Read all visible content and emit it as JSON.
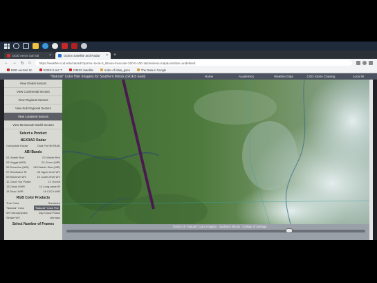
{
  "browser": {
    "tabs": [
      {
        "label": "DOD Aeros Sal Sal"
      },
      {
        "label": "GOES Satellite and Radar"
      }
    ],
    "url": "https://weather.cod.edu/satrad/?parms=local-S_Illinois-truecolor-200-0-100-1&checked=map&colorbar=undefined",
    "bookmarks": [
      {
        "label": "DOD Aerosol Sc",
        "color": "#cc2a2a"
      },
      {
        "label": "GOES Ε Δ Ε Τ",
        "color": "#cc2a2a"
      },
      {
        "label": "CIMSS Satellite",
        "color": "#cc2a2a"
      },
      {
        "label": "Index of /data_goes",
        "color": "#d6a33a"
      },
      {
        "label": "The Data in Google",
        "color": "#d6a33a"
      }
    ]
  },
  "page": {
    "title": "\"Natural\" Color Hier Imagery for Southern Illinois (GOES East)",
    "nav": [
      "Home",
      "Academics",
      "Weather Data",
      "COD Storm Chasing",
      "Local W"
    ]
  },
  "sidebar": {
    "view_links": [
      {
        "label": "View Global Sectors"
      },
      {
        "label": "View Continental Sectors"
      },
      {
        "label": "View Regional Sectors"
      },
      {
        "label": "View Sub Regional Sectors"
      },
      {
        "label": "View Localized Sectors"
      },
      {
        "label": "View Mesoscale Model Sectors"
      }
    ],
    "select_product": "Select a Product",
    "nexrad_head": "NEXRAD Radar",
    "nexrad_items": [
      "Composite Radar",
      "Dual Pol NEXRAD"
    ],
    "abi_head": "ABI Bands",
    "abi_rows": [
      [
        "01 Visible Blue",
        "02 Visible Red"
      ],
      [
        "03 Veggie (NIR)",
        "04 Cirrus (NIR)"
      ],
      [
        "05 Snow/Ice (NIR)",
        "06 Particle Size (NIR)"
      ],
      [
        "07 Shortwave IR",
        "08 Upper-level WV"
      ],
      [
        "09 Mid-level WV",
        "10 Lower-level WV"
      ],
      [
        "11 Cloud Top Phase",
        "12 Ozone"
      ],
      [
        "13 Clean LWIR",
        "14 Long-wave IR"
      ],
      [
        "15 Dirty LWIR",
        "16 CO2 LWIR"
      ]
    ],
    "rgb_head": "RGB Color Products",
    "rgb_rows": [
      [
        "True Color",
        "Sandwich"
      ],
      [
        "\"Natural\" Color",
        "\"Natural\" Color Fire"
      ],
      [
        "WV Microphysics",
        "Day Cloud Phase"
      ],
      [
        "Simple WV",
        "Airmass"
      ]
    ],
    "bottom_head": "Select Number of Frames"
  },
  "viewer": {
    "caption": "GOES-16 \"Natural\" Color Imagery · Southern Illinois · College of DuPage",
    "slider_position": 0.75
  }
}
